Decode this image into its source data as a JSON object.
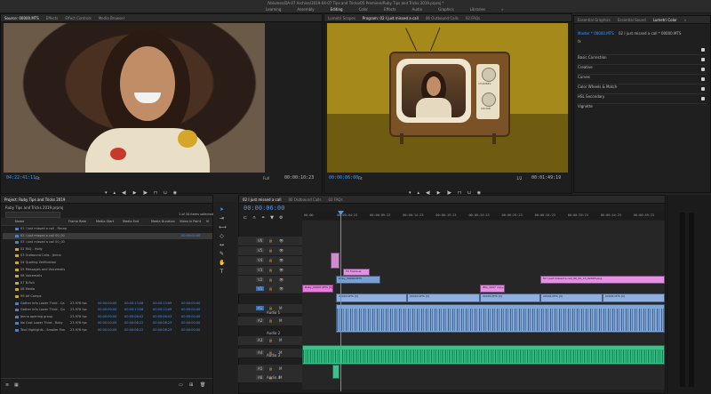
{
  "window": {
    "title": "/Volumes/DA-07 Archive/2019-04-07 Tips and Tricks/05 Premiere/Ruby Tips and Tricks 2019.prproj *"
  },
  "workspaces": [
    "Learning",
    "Assembly",
    "Editing",
    "Color",
    "Effects",
    "Audio",
    "Graphics",
    "Libraries",
    "»"
  ],
  "source_panel": {
    "tabs": [
      "Source: 00000.MTS",
      "Effects",
      "Effect Controls",
      "Media Browser"
    ],
    "timecode_in": "04:22:41:11",
    "fit": "Fit",
    "zoom": "Full",
    "duration": "00:00:10:23"
  },
  "program_panel": {
    "tabs": [
      "Lumetri Scopes",
      "Program: 02 I just missed a call",
      "06 Outbound Calls",
      "02 FAQs"
    ],
    "timecode": "00:00:06:00",
    "fit": "Fit",
    "zoom": "1/2",
    "duration": "00:01:49:19",
    "tv_labels": [
      "CHANNEL",
      "SOUND"
    ]
  },
  "lumetri_panel": {
    "tabs": [
      "Essential Graphics",
      "Essential Sound",
      "Lumetri Color",
      "»"
    ],
    "clip_path": "Master * 00000.MTS",
    "sequence_path": "02 I just missed a call * 00000.MTS",
    "fx_label": "fx",
    "sections": [
      "Basic Correction",
      "Creative",
      "Curves",
      "Color Wheels & Match",
      "HSL Secondary",
      "Vignette"
    ]
  },
  "project_panel": {
    "title": "Project: Ruby Tips and Tricks 2019",
    "file": "Ruby Tips and Tricks 2019.prproj",
    "selection": "1 of 34 items selected",
    "columns": [
      "Name",
      "Frame Rate",
      "Media Start",
      "Media End",
      "Media Duration",
      "Video In Point",
      "Vi"
    ],
    "items": [
      {
        "name": "01 I just missed a call - Recep",
        "type": "seq",
        "fps": "",
        "start": "",
        "end": "",
        "dur": "",
        "vin": ""
      },
      {
        "name": "02 I just missed a call 00_00",
        "type": "seq",
        "fps": "",
        "start": "",
        "end": "",
        "dur": "",
        "vin": "00:00:00:00"
      },
      {
        "name": "03 I just missed a call 00_00",
        "type": "seq",
        "fps": "",
        "start": "",
        "end": "",
        "dur": "",
        "vin": ""
      },
      {
        "name": "02 FAQ - Holly",
        "type": "folder",
        "fps": "",
        "start": "",
        "end": "",
        "dur": "",
        "vin": ""
      },
      {
        "name": "03 Outbound Calls - Jenna",
        "type": "folder",
        "fps": "",
        "start": "",
        "end": "",
        "dur": "",
        "vin": ""
      },
      {
        "name": "04 Quoting Verification",
        "type": "folder",
        "fps": "",
        "start": "",
        "end": "",
        "dur": "",
        "vin": ""
      },
      {
        "name": "05 Messages and Voicemails",
        "type": "folder",
        "fps": "",
        "start": "",
        "end": "",
        "dur": "",
        "vin": ""
      },
      {
        "name": "06 Voicemails",
        "type": "folder",
        "fps": "",
        "start": "",
        "end": "",
        "dur": "",
        "vin": ""
      },
      {
        "name": "07 B-Roll",
        "type": "folder",
        "fps": "",
        "start": "",
        "end": "",
        "dur": "",
        "vin": ""
      },
      {
        "name": "08 Media",
        "type": "folder",
        "fps": "",
        "start": "",
        "end": "",
        "dur": "",
        "vin": ""
      },
      {
        "name": "99 Alt Comps",
        "type": "folder",
        "fps": "",
        "start": "",
        "end": "",
        "dur": "",
        "vin": ""
      },
      {
        "name": "Gather Info Lower Third - Ca",
        "type": "clip",
        "fps": "23.976 fps",
        "start": "00:00:00:00",
        "end": "00:00:13:08",
        "dur": "00:00:13:09",
        "vin": "00:00:00:00"
      },
      {
        "name": "Gather Info Lower Third - Qu",
        "type": "clip",
        "fps": "23.976 fps",
        "start": "00:00:00:00",
        "end": "00:00:13:08",
        "dur": "00:00:13:09",
        "vin": "00:00:00:00"
      },
      {
        "name": "Jenna opening group",
        "type": "clip",
        "fps": "23.976 fps",
        "start": "00:00:00:00",
        "end": "00:00:08:02",
        "dur": "00:00:08:03",
        "vin": "00:00:00:00"
      },
      {
        "name": "No Cost Lower Third - Ruby",
        "type": "clip",
        "fps": "23.976 fps",
        "start": "00:00:00:00",
        "end": "00:00:06:22",
        "dur": "00:00:06:23",
        "vin": "00:00:00:00"
      },
      {
        "name": "Text Highlights - Smaller Fon",
        "type": "clip",
        "fps": "23.976 fps",
        "start": "00:00:00:00",
        "end": "00:00:06:22",
        "dur": "00:00:06:23",
        "vin": "00:00:00:00"
      }
    ]
  },
  "timeline": {
    "tabs": [
      "02 I just missed a call",
      "06 Outbound Calls",
      "02 FAQs"
    ],
    "timecode": "00:00:06:00",
    "ruler": [
      "00:00",
      "00:00:04:23",
      "00:00:09:23",
      "00:00:14:23",
      "00:00:19:23",
      "00:00:24:23",
      "00:00:29:23",
      "00:00:34:23",
      "00:00:39:23",
      "00:00:44:23",
      "00:00:49:23"
    ],
    "tracks": [
      "V6",
      "V5",
      "V4",
      "V3",
      "V2",
      "V1",
      "A1",
      "A2",
      "A3",
      "A4",
      "A5",
      "A6"
    ],
    "audio_names": [
      "Audio 1",
      "Audio 2",
      "Audio 3",
      "Audio 4"
    ],
    "clip_labels": {
      "tv_frame": "TV frame.ai",
      "graphic": "Ruby_00000.MTS",
      "lower_third": "Ruby_00007.MTS [V]",
      "v1_a": "00000.MTS [V]",
      "v1_b": "00000.MTS [V]",
      "v1_c": "00003.MTS [V]",
      "v1_d": "00004.MTS [V]",
      "v1_e": "00005.MTS [V]",
      "png": "IMG_3247 copy.png",
      "png2": "02 I just missed a call_00_00_13_02003.png"
    }
  }
}
